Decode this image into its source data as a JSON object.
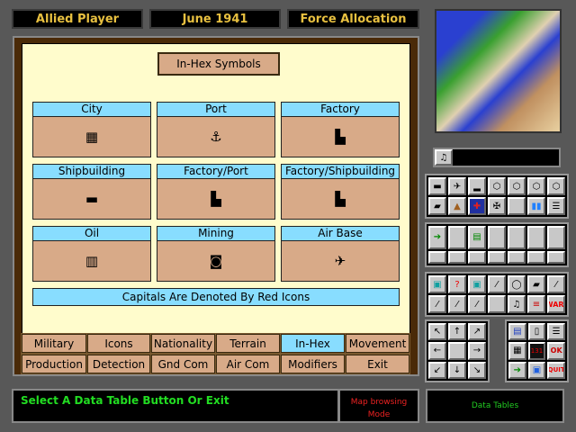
{
  "header": {
    "player": "Allied Player",
    "date": "June 1941",
    "mode": "Force Allocation"
  },
  "panel": {
    "title": "In-Hex Symbols",
    "symbols": [
      {
        "label": "City",
        "icon": "city-icon",
        "glyph": "▦"
      },
      {
        "label": "Port",
        "icon": "anchor-icon",
        "glyph": "⚓"
      },
      {
        "label": "Factory",
        "icon": "factory-icon",
        "glyph": "▙"
      },
      {
        "label": "Shipbuilding",
        "icon": "ship-icon",
        "glyph": "▬"
      },
      {
        "label": "Factory/Port",
        "icon": "factory-port-icon",
        "glyph": "▙"
      },
      {
        "label": "Factory/Shipbuilding",
        "icon": "factory-shipbuilding-icon",
        "glyph": "▙"
      },
      {
        "label": "Oil",
        "icon": "oil-icon",
        "glyph": "▥"
      },
      {
        "label": "Mining",
        "icon": "mining-icon",
        "glyph": "◙"
      },
      {
        "label": "Air Base",
        "icon": "airbase-icon",
        "glyph": "✈"
      }
    ],
    "capitals_note": "Capitals Are Denoted By Red Icons"
  },
  "tabs": [
    "Military",
    "Icons",
    "Nationality",
    "Terrain",
    "In-Hex",
    "Movement",
    "Production",
    "Detection",
    "Gnd Com",
    "Air Com",
    "Modifiers",
    "Exit"
  ],
  "active_tab": "In-Hex",
  "status": {
    "message": "Select A Data Table Button Or Exit",
    "mode_line1": "Map browsing",
    "mode_line2": "Mode",
    "context": "Data Tables"
  },
  "right": {
    "war_label": "WAR!",
    "quit_label": "QUIT",
    "ok_label": "OK",
    "counter": "131"
  }
}
